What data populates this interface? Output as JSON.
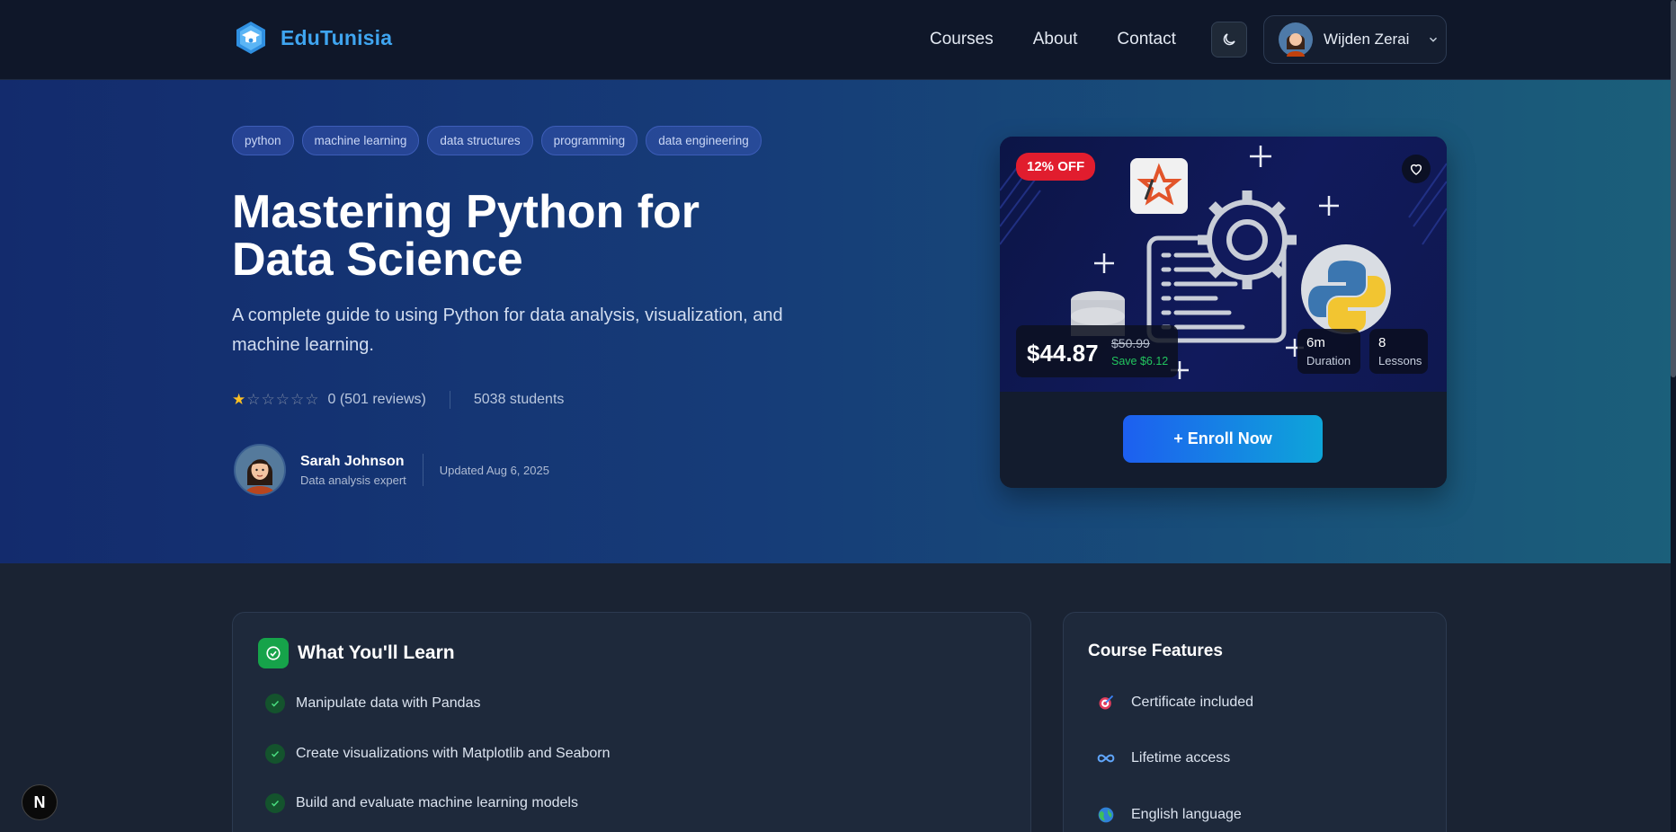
{
  "brand": {
    "name": "EduTunisia"
  },
  "nav": {
    "items": [
      "Courses",
      "About",
      "Contact"
    ]
  },
  "user": {
    "name": "Wijden Zerai"
  },
  "course": {
    "tags": [
      "python",
      "machine learning",
      "data structures",
      "programming",
      "data engineering"
    ],
    "title": "Mastering Python for Data Science",
    "subtitle": "A complete guide to using Python for data analysis, visualization, and machine learning.",
    "rating": {
      "filled_stars": 1,
      "total_stars": 6,
      "text": "0 (501 reviews)"
    },
    "students": "5038 students",
    "instructor": {
      "name": "Sarah Johnson",
      "role": "Data analysis expert"
    },
    "updated": "Updated Aug 6, 2025"
  },
  "card": {
    "discount": "12% OFF",
    "price": "$44.87",
    "old_price": "$50.99",
    "save": "Save $6.12",
    "duration": {
      "value": "6m",
      "label": "Duration"
    },
    "lessons": {
      "value": "8",
      "label": "Lessons"
    },
    "enroll_label": "+ Enroll Now"
  },
  "learn": {
    "title": "What You'll Learn",
    "items": [
      "Manipulate data with Pandas",
      "Create visualizations with Matplotlib and Seaborn",
      "Build and evaluate machine learning models"
    ]
  },
  "features": {
    "title": "Course Features",
    "items": [
      {
        "label": "Certificate included",
        "icon": "certificate-icon"
      },
      {
        "label": "Lifetime access",
        "icon": "infinity-icon"
      },
      {
        "label": "English language",
        "icon": "globe-icon"
      }
    ]
  },
  "colors": {
    "accent": "#3fa5f0",
    "discount": "#e11d2e",
    "save": "#22c55e",
    "check": "#16a34a"
  }
}
